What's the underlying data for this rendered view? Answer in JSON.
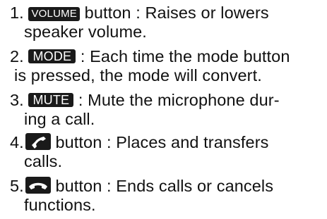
{
  "items": [
    {
      "num": "1.",
      "badge": "VOLUME",
      "line1": " button : Raises or lowers",
      "line2": "speaker volume."
    },
    {
      "num": "2.",
      "badge": "MODE",
      "line1": " : Each time the mode button",
      "line2": "is pressed, the mode will convert."
    },
    {
      "num": "3.",
      "badge": "MUTE",
      "line1": " : Mute the microphone dur-",
      "line2": "ing a call."
    },
    {
      "num": "4.",
      "icon": "call-handset-icon",
      "line1": " button : Places and transfers",
      "line2": "calls."
    },
    {
      "num": "5.",
      "icon": "end-call-handset-icon",
      "line1": " button : Ends calls or cancels",
      "line2": "functions."
    }
  ]
}
